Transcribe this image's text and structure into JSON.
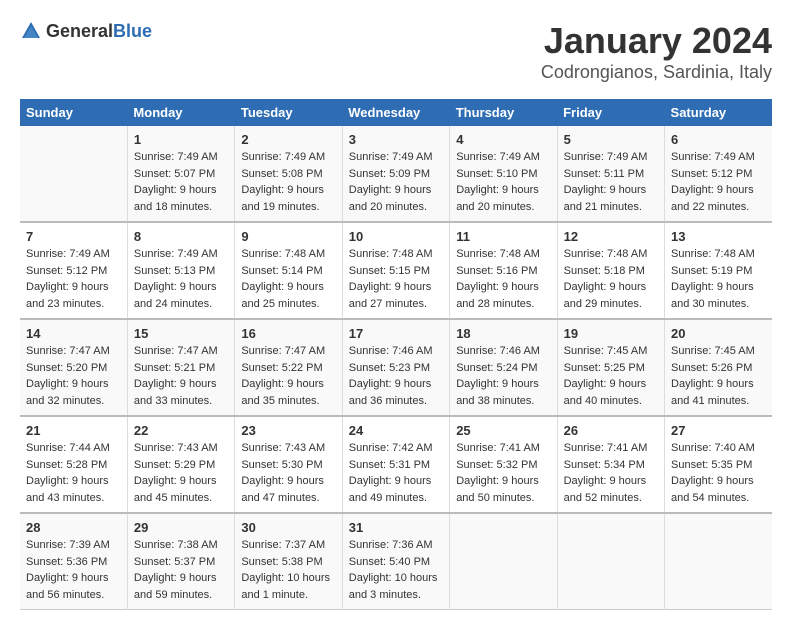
{
  "header": {
    "logo_general": "General",
    "logo_blue": "Blue",
    "title": "January 2024",
    "subtitle": "Codrongianos, Sardinia, Italy"
  },
  "calendar": {
    "weekdays": [
      "Sunday",
      "Monday",
      "Tuesday",
      "Wednesday",
      "Thursday",
      "Friday",
      "Saturday"
    ],
    "weeks": [
      [
        {
          "day": "",
          "sunrise": "",
          "sunset": "",
          "daylight": ""
        },
        {
          "day": "1",
          "sunrise": "Sunrise: 7:49 AM",
          "sunset": "Sunset: 5:07 PM",
          "daylight": "Daylight: 9 hours and 18 minutes."
        },
        {
          "day": "2",
          "sunrise": "Sunrise: 7:49 AM",
          "sunset": "Sunset: 5:08 PM",
          "daylight": "Daylight: 9 hours and 19 minutes."
        },
        {
          "day": "3",
          "sunrise": "Sunrise: 7:49 AM",
          "sunset": "Sunset: 5:09 PM",
          "daylight": "Daylight: 9 hours and 20 minutes."
        },
        {
          "day": "4",
          "sunrise": "Sunrise: 7:49 AM",
          "sunset": "Sunset: 5:10 PM",
          "daylight": "Daylight: 9 hours and 20 minutes."
        },
        {
          "day": "5",
          "sunrise": "Sunrise: 7:49 AM",
          "sunset": "Sunset: 5:11 PM",
          "daylight": "Daylight: 9 hours and 21 minutes."
        },
        {
          "day": "6",
          "sunrise": "Sunrise: 7:49 AM",
          "sunset": "Sunset: 5:12 PM",
          "daylight": "Daylight: 9 hours and 22 minutes."
        }
      ],
      [
        {
          "day": "7",
          "sunrise": "Sunrise: 7:49 AM",
          "sunset": "Sunset: 5:12 PM",
          "daylight": "Daylight: 9 hours and 23 minutes."
        },
        {
          "day": "8",
          "sunrise": "Sunrise: 7:49 AM",
          "sunset": "Sunset: 5:13 PM",
          "daylight": "Daylight: 9 hours and 24 minutes."
        },
        {
          "day": "9",
          "sunrise": "Sunrise: 7:48 AM",
          "sunset": "Sunset: 5:14 PM",
          "daylight": "Daylight: 9 hours and 25 minutes."
        },
        {
          "day": "10",
          "sunrise": "Sunrise: 7:48 AM",
          "sunset": "Sunset: 5:15 PM",
          "daylight": "Daylight: 9 hours and 27 minutes."
        },
        {
          "day": "11",
          "sunrise": "Sunrise: 7:48 AM",
          "sunset": "Sunset: 5:16 PM",
          "daylight": "Daylight: 9 hours and 28 minutes."
        },
        {
          "day": "12",
          "sunrise": "Sunrise: 7:48 AM",
          "sunset": "Sunset: 5:18 PM",
          "daylight": "Daylight: 9 hours and 29 minutes."
        },
        {
          "day": "13",
          "sunrise": "Sunrise: 7:48 AM",
          "sunset": "Sunset: 5:19 PM",
          "daylight": "Daylight: 9 hours and 30 minutes."
        }
      ],
      [
        {
          "day": "14",
          "sunrise": "Sunrise: 7:47 AM",
          "sunset": "Sunset: 5:20 PM",
          "daylight": "Daylight: 9 hours and 32 minutes."
        },
        {
          "day": "15",
          "sunrise": "Sunrise: 7:47 AM",
          "sunset": "Sunset: 5:21 PM",
          "daylight": "Daylight: 9 hours and 33 minutes."
        },
        {
          "day": "16",
          "sunrise": "Sunrise: 7:47 AM",
          "sunset": "Sunset: 5:22 PM",
          "daylight": "Daylight: 9 hours and 35 minutes."
        },
        {
          "day": "17",
          "sunrise": "Sunrise: 7:46 AM",
          "sunset": "Sunset: 5:23 PM",
          "daylight": "Daylight: 9 hours and 36 minutes."
        },
        {
          "day": "18",
          "sunrise": "Sunrise: 7:46 AM",
          "sunset": "Sunset: 5:24 PM",
          "daylight": "Daylight: 9 hours and 38 minutes."
        },
        {
          "day": "19",
          "sunrise": "Sunrise: 7:45 AM",
          "sunset": "Sunset: 5:25 PM",
          "daylight": "Daylight: 9 hours and 40 minutes."
        },
        {
          "day": "20",
          "sunrise": "Sunrise: 7:45 AM",
          "sunset": "Sunset: 5:26 PM",
          "daylight": "Daylight: 9 hours and 41 minutes."
        }
      ],
      [
        {
          "day": "21",
          "sunrise": "Sunrise: 7:44 AM",
          "sunset": "Sunset: 5:28 PM",
          "daylight": "Daylight: 9 hours and 43 minutes."
        },
        {
          "day": "22",
          "sunrise": "Sunrise: 7:43 AM",
          "sunset": "Sunset: 5:29 PM",
          "daylight": "Daylight: 9 hours and 45 minutes."
        },
        {
          "day": "23",
          "sunrise": "Sunrise: 7:43 AM",
          "sunset": "Sunset: 5:30 PM",
          "daylight": "Daylight: 9 hours and 47 minutes."
        },
        {
          "day": "24",
          "sunrise": "Sunrise: 7:42 AM",
          "sunset": "Sunset: 5:31 PM",
          "daylight": "Daylight: 9 hours and 49 minutes."
        },
        {
          "day": "25",
          "sunrise": "Sunrise: 7:41 AM",
          "sunset": "Sunset: 5:32 PM",
          "daylight": "Daylight: 9 hours and 50 minutes."
        },
        {
          "day": "26",
          "sunrise": "Sunrise: 7:41 AM",
          "sunset": "Sunset: 5:34 PM",
          "daylight": "Daylight: 9 hours and 52 minutes."
        },
        {
          "day": "27",
          "sunrise": "Sunrise: 7:40 AM",
          "sunset": "Sunset: 5:35 PM",
          "daylight": "Daylight: 9 hours and 54 minutes."
        }
      ],
      [
        {
          "day": "28",
          "sunrise": "Sunrise: 7:39 AM",
          "sunset": "Sunset: 5:36 PM",
          "daylight": "Daylight: 9 hours and 56 minutes."
        },
        {
          "day": "29",
          "sunrise": "Sunrise: 7:38 AM",
          "sunset": "Sunset: 5:37 PM",
          "daylight": "Daylight: 9 hours and 59 minutes."
        },
        {
          "day": "30",
          "sunrise": "Sunrise: 7:37 AM",
          "sunset": "Sunset: 5:38 PM",
          "daylight": "Daylight: 10 hours and 1 minute."
        },
        {
          "day": "31",
          "sunrise": "Sunrise: 7:36 AM",
          "sunset": "Sunset: 5:40 PM",
          "daylight": "Daylight: 10 hours and 3 minutes."
        },
        {
          "day": "",
          "sunrise": "",
          "sunset": "",
          "daylight": ""
        },
        {
          "day": "",
          "sunrise": "",
          "sunset": "",
          "daylight": ""
        },
        {
          "day": "",
          "sunrise": "",
          "sunset": "",
          "daylight": ""
        }
      ]
    ]
  }
}
